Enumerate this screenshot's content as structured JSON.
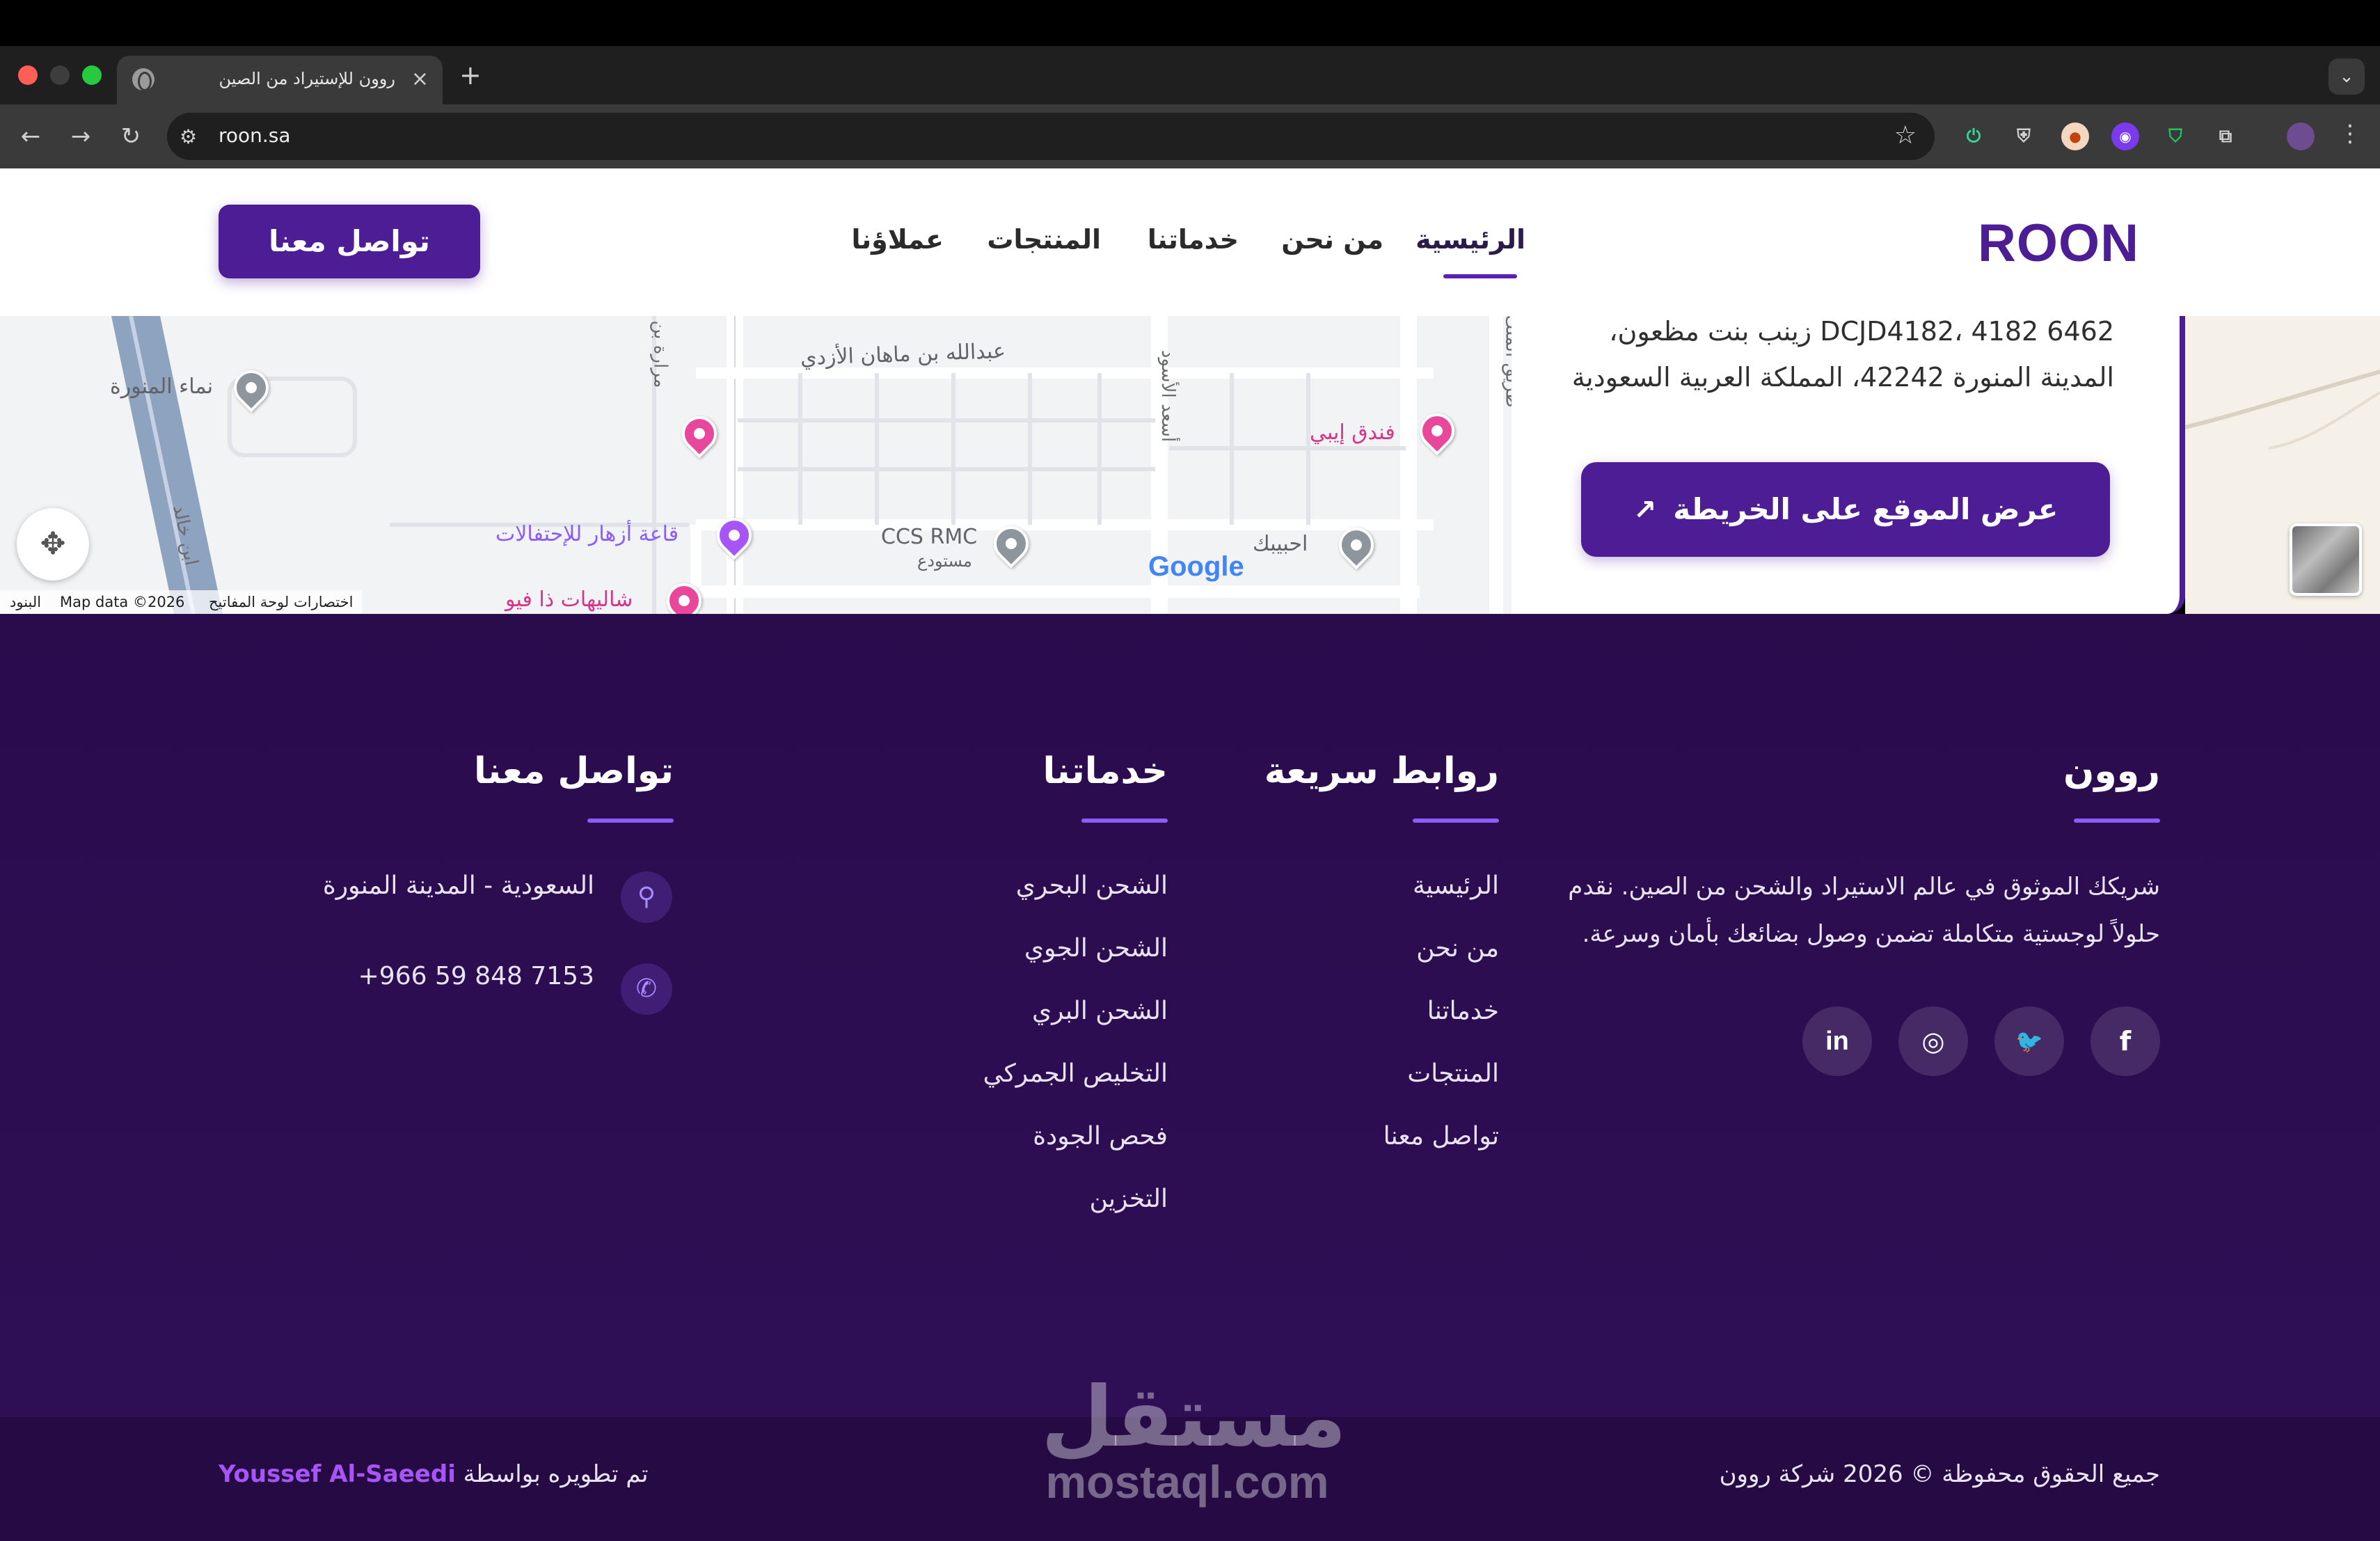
{
  "browser": {
    "tab_title": "روون للإستيراد من الصين",
    "tab_close": "×",
    "new_tab": "+",
    "url": "roon.sa",
    "tab_search": "⌄",
    "icons": [
      "back-arrow-icon",
      "forward-arrow-icon",
      "reload-icon",
      "site-settings-icon",
      "bookmark-star-icon",
      "extension-power-icon",
      "extension-shield-icon",
      "extension-badge-icon",
      "extension-vpn-icon",
      "extension-adblock-icon",
      "extensions-puzzle-icon",
      "profile-avatar-icon",
      "menu-dots-icon"
    ]
  },
  "header": {
    "logo": "ROON",
    "nav": [
      {
        "label": "الرئيسية",
        "active": true
      },
      {
        "label": "من نحن"
      },
      {
        "label": "خدماتنا"
      },
      {
        "label": "المنتجات"
      },
      {
        "label": "عملاؤنا"
      }
    ],
    "cta": "تواصل معنا",
    "colors": {
      "brand": "#4c1d95",
      "accent": "#8b5cf6"
    }
  },
  "map": {
    "labels": {
      "namaa": "نماء المنورة",
      "abdullah": "عبدالله بن ماهان الأزدي",
      "hotel": "فندق إيبي",
      "azhar": "قاعة أزهار للإحتفالات",
      "ccs": "CCS RMC",
      "warehouse": "مستودع",
      "habibak": "احبيبك",
      "shalihat": "شاليهات ذا فيو",
      "road_left": "ابن خالد",
      "road_asad": "أسعد الأسود",
      "road_king": "طريق الملك",
      "road_marah": "مرارة بن"
    },
    "google": "Google",
    "attribution": {
      "terms": "البنود",
      "data": "Map data ©2026",
      "shortcuts": "اختصارات لوحة المفاتيح"
    }
  },
  "location": {
    "address_line1": "DCJD4182، 4182 6462 زينب بنت مظعون،",
    "address_line2": "المدينة المنورة 42242، المملكة العربية السعودية",
    "map_button": "عرض الموقع على الخريطة"
  },
  "footer": {
    "about": {
      "title": "روون",
      "text": "شريكك الموثوق في عالم الاستيراد والشحن من الصين. نقدم حلولاً لوجستية متكاملة تضمن وصول بضائعك بأمان وسرعة."
    },
    "social": [
      {
        "icon": "facebook-icon",
        "glyph": "f"
      },
      {
        "icon": "twitter-icon",
        "glyph": "🐦"
      },
      {
        "icon": "instagram-icon",
        "glyph": "◎"
      },
      {
        "icon": "linkedin-icon",
        "glyph": "in"
      }
    ],
    "quick_links": {
      "title": "روابط سريعة",
      "items": [
        "الرئيسية",
        "من نحن",
        "خدماتنا",
        "المنتجات",
        "تواصل معنا"
      ]
    },
    "services": {
      "title": "خدماتنا",
      "items": [
        "الشحن البحري",
        "الشحن الجوي",
        "الشحن البري",
        "التخليص الجمركي",
        "فحص الجودة",
        "التخزين"
      ]
    },
    "contact": {
      "title": "تواصل معنا",
      "address": "السعودية - المدينة المنورة",
      "phone": "+966 59 848 7153"
    },
    "copyright": "جميع الحقوق محفوظة © 2026 شركة روون",
    "developed_by": "تم تطويره بواسطة",
    "developer": "Youssef Al-Saeedi"
  },
  "watermark": {
    "arabic": "مستقل",
    "latin": "mostaql.com"
  }
}
